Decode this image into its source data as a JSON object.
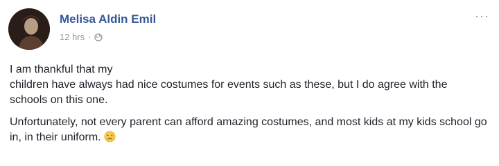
{
  "post": {
    "author": "Melisa Aldin Emil",
    "time": "12 hrs",
    "separator": "·",
    "privacy_icon": "globe-icon",
    "more_label": "···",
    "paragraphs": [
      "I am thankful that my\nchildren have always had nice costumes for events such as these, but I do agree with the schools on this one.",
      "Unfortunately, not every parent can afford amazing costumes, and most kids at my kids school go in, in their uniform."
    ],
    "emoji": "crying-face-icon"
  },
  "colors": {
    "author": "#365899",
    "meta": "#90949c",
    "text": "#1d2129"
  }
}
